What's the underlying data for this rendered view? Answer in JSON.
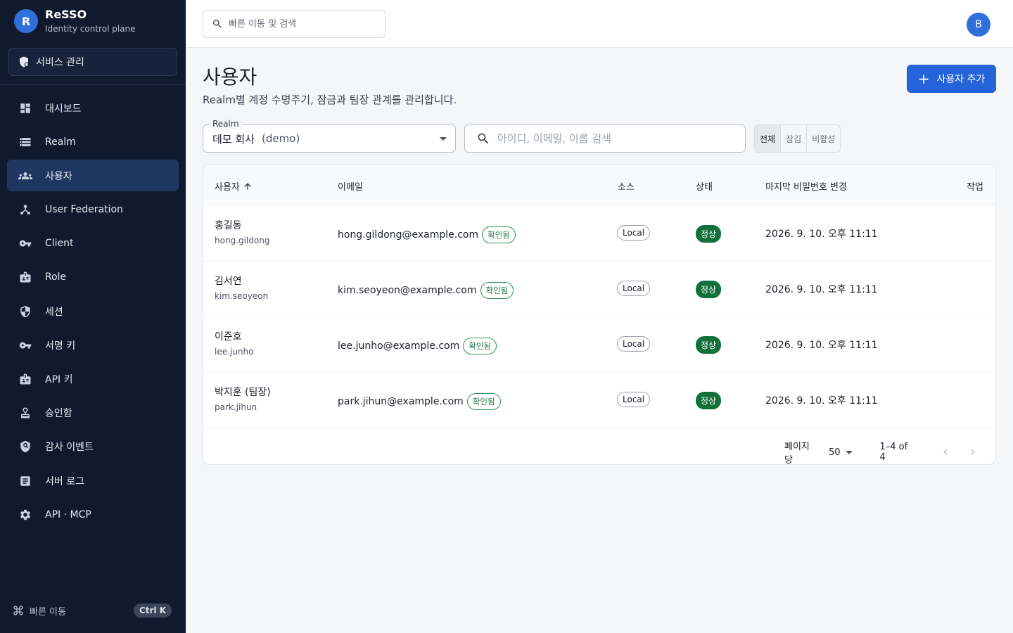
{
  "brand": {
    "logo_letter": "R",
    "name": "ReSSO",
    "subtitle": "Identity control plane"
  },
  "sidebar": {
    "service_button": "서비스 관리",
    "items": [
      {
        "label": "대시보드",
        "icon": "dashboard-icon"
      },
      {
        "label": "Realm",
        "icon": "storage-icon"
      },
      {
        "label": "사용자",
        "icon": "people-icon",
        "active": true
      },
      {
        "label": "User Federation",
        "icon": "federation-icon"
      },
      {
        "label": "Client",
        "icon": "key-icon"
      },
      {
        "label": "Role",
        "icon": "badge-icon"
      },
      {
        "label": "세션",
        "icon": "shield-icon"
      },
      {
        "label": "서명 키",
        "icon": "key-icon"
      },
      {
        "label": "API 키",
        "icon": "badge-icon"
      },
      {
        "label": "승인함",
        "icon": "approval-icon"
      },
      {
        "label": "감사 이벤트",
        "icon": "audit-icon"
      },
      {
        "label": "서버 로그",
        "icon": "log-icon"
      },
      {
        "label": "API · MCP",
        "icon": "gear-icon"
      }
    ],
    "quick_nav": {
      "label": "빠른 이동",
      "shortcut": "Ctrl K"
    }
  },
  "topbar": {
    "search_placeholder": "빠른 이동 및 검색",
    "avatar_letter": "B"
  },
  "page": {
    "title": "사용자",
    "description": "Realm별 계정 수명주기, 잠금과 팀장 관계를 관리합니다.",
    "add_button": "사용자 추가"
  },
  "filters": {
    "realm_label": "Realm",
    "realm_name": "데모 회사",
    "realm_code": "(demo)",
    "search_placeholder": "아이디, 이메일, 이름 검색",
    "status_options": [
      "전체",
      "잠김",
      "비활성"
    ],
    "status_selected": "전체"
  },
  "table": {
    "columns": [
      "사용자",
      "이메일",
      "소스",
      "상태",
      "마지막 비밀번호 변경",
      "작업"
    ],
    "sort_column": "사용자",
    "sort_direction": "asc",
    "rows": [
      {
        "name": "홍길동",
        "username": "hong.gildong",
        "email": "hong.gildong@example.com",
        "verified": "확인됨",
        "source": "Local",
        "status": "정상",
        "password_changed": "2026. 9. 10. 오후 11:11"
      },
      {
        "name": "김서연",
        "username": "kim.seoyeon",
        "email": "kim.seoyeon@example.com",
        "verified": "확인됨",
        "source": "Local",
        "status": "정상",
        "password_changed": "2026. 9. 10. 오후 11:11"
      },
      {
        "name": "이준호",
        "username": "lee.junho",
        "email": "lee.junho@example.com",
        "verified": "확인됨",
        "source": "Local",
        "status": "정상",
        "password_changed": "2026. 9. 10. 오후 11:11"
      },
      {
        "name": "박지훈 (팀장)",
        "username": "park.jihun",
        "email": "park.jihun@example.com",
        "verified": "확인됨",
        "source": "Local",
        "status": "정상",
        "password_changed": "2026. 9. 10. 오후 11:11"
      }
    ]
  },
  "pagination": {
    "rows_per_page_label": "페이지당",
    "rows_per_page": "50",
    "range": "1–4 of 4"
  },
  "colors": {
    "sidebar_bg": "#0f1a2e",
    "sidebar_active": "#1f3760",
    "primary": "#2563d8",
    "status_ok": "#12703b",
    "verified": "#1d7a46"
  }
}
